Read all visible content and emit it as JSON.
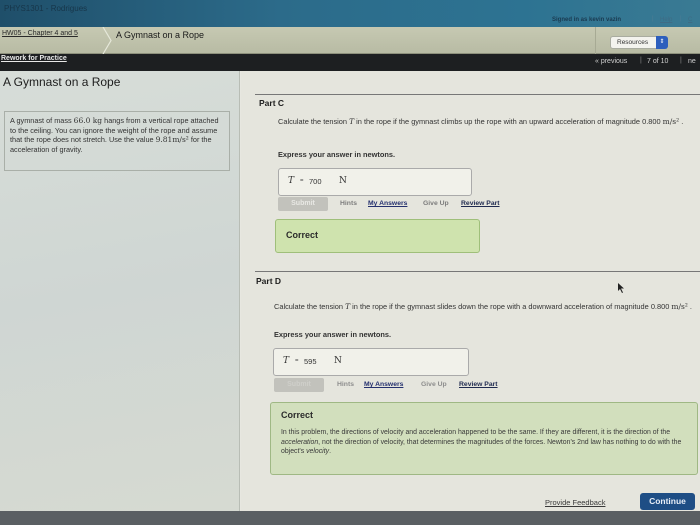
{
  "header": {
    "course": "PHYS1301 - Rodrigues",
    "signed_in": "Signed in as kevin vazin",
    "help": "Help",
    "close": "C"
  },
  "breadcrumb": {
    "assignment": "HW05 - Chapter 4 and 5",
    "current": "A Gymnast on a Rope",
    "resources_select": "Resources"
  },
  "nav": {
    "rework": "Rework for Practice",
    "previous": "« previous",
    "position": "7 of 10",
    "next": "ne"
  },
  "problem": {
    "title": "A Gymnast on a Rope",
    "text_1": "A gymnast of mass ",
    "mass": "66.0 kg",
    "text_2": " hangs from a vertical rope attached to the ceiling. You can ignore the weight of the rope and assume that the rope does not stretch. Use the value ",
    "gravity": "9.81m/s²",
    "text_3": " for the acceleration of gravity."
  },
  "parts": [
    {
      "title": "Part C",
      "question_1": "Calculate the tension ",
      "var": "T",
      "question_2": " in the rope if the gymnast climbs up the rope with an upward acceleration of magnitude 0.800 ",
      "unit_acc": "m/s²",
      "question_3": " .",
      "express": "Express your answer in newtons.",
      "answer_var": "T",
      "answer_eq": "=",
      "answer_value": "700",
      "answer_unit": "N",
      "submit": "Submit",
      "hints": "Hints",
      "my_answers": "My Answers",
      "give_up": "Give Up",
      "review": "Review Part",
      "result": "Correct"
    },
    {
      "title": "Part D",
      "question_1": "Calculate the tension ",
      "var": "T",
      "question_2": " in the rope if the gymnast slides down the rope with a downward acceleration of magnitude 0.800 ",
      "unit_acc": "m/s²",
      "question_3": " .",
      "express": "Express your answer in newtons.",
      "answer_var": "T",
      "answer_eq": "=",
      "answer_value": "595",
      "answer_unit": "N",
      "submit": "Submit",
      "hints": "Hints",
      "my_answers": "My Answers",
      "give_up": "Give Up",
      "review": "Review Part",
      "result": "Correct",
      "feedback_1": "In this problem, the directions of velocity and acceleration happened to be the same. If they are different, it is the direction of the ",
      "feedback_em1": "acceleration",
      "feedback_2": ", not the direction of velocity, that determines the magnitudes of the forces. Newton's 2nd law has nothing to do with the object's ",
      "feedback_em2": "velocity",
      "feedback_3": "."
    }
  ],
  "footer": {
    "provide_feedback": "Provide Feedback",
    "continue": "Continue"
  },
  "colors": {
    "correct_bg": "#cfe3ae",
    "continue_bg": "#1e4e85",
    "resources_accent": "#2d5fbd"
  }
}
